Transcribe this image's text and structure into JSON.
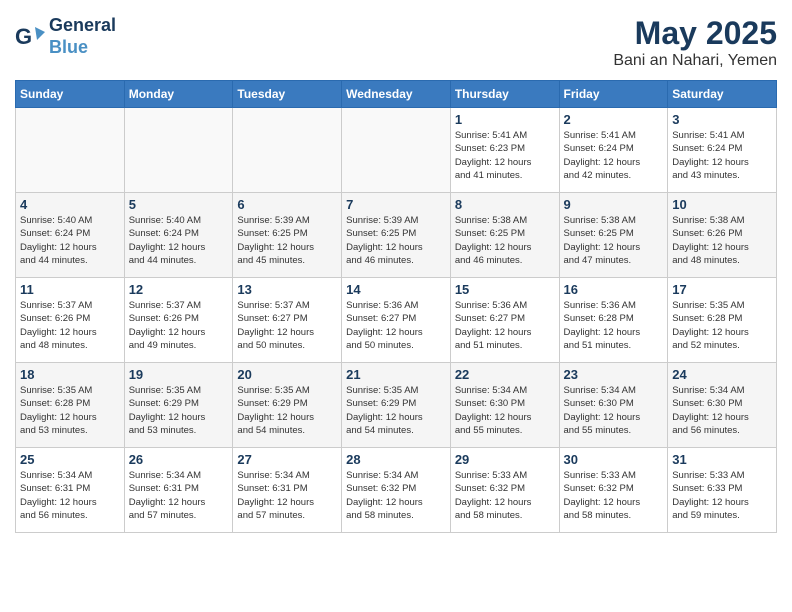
{
  "header": {
    "logo_line1": "General",
    "logo_line2": "Blue",
    "month": "May 2025",
    "location": "Bani an Nahari, Yemen"
  },
  "weekdays": [
    "Sunday",
    "Monday",
    "Tuesday",
    "Wednesday",
    "Thursday",
    "Friday",
    "Saturday"
  ],
  "weeks": [
    [
      {
        "day": "",
        "info": ""
      },
      {
        "day": "",
        "info": ""
      },
      {
        "day": "",
        "info": ""
      },
      {
        "day": "",
        "info": ""
      },
      {
        "day": "1",
        "info": "Sunrise: 5:41 AM\nSunset: 6:23 PM\nDaylight: 12 hours\nand 41 minutes."
      },
      {
        "day": "2",
        "info": "Sunrise: 5:41 AM\nSunset: 6:24 PM\nDaylight: 12 hours\nand 42 minutes."
      },
      {
        "day": "3",
        "info": "Sunrise: 5:41 AM\nSunset: 6:24 PM\nDaylight: 12 hours\nand 43 minutes."
      }
    ],
    [
      {
        "day": "4",
        "info": "Sunrise: 5:40 AM\nSunset: 6:24 PM\nDaylight: 12 hours\nand 44 minutes."
      },
      {
        "day": "5",
        "info": "Sunrise: 5:40 AM\nSunset: 6:24 PM\nDaylight: 12 hours\nand 44 minutes."
      },
      {
        "day": "6",
        "info": "Sunrise: 5:39 AM\nSunset: 6:25 PM\nDaylight: 12 hours\nand 45 minutes."
      },
      {
        "day": "7",
        "info": "Sunrise: 5:39 AM\nSunset: 6:25 PM\nDaylight: 12 hours\nand 46 minutes."
      },
      {
        "day": "8",
        "info": "Sunrise: 5:38 AM\nSunset: 6:25 PM\nDaylight: 12 hours\nand 46 minutes."
      },
      {
        "day": "9",
        "info": "Sunrise: 5:38 AM\nSunset: 6:25 PM\nDaylight: 12 hours\nand 47 minutes."
      },
      {
        "day": "10",
        "info": "Sunrise: 5:38 AM\nSunset: 6:26 PM\nDaylight: 12 hours\nand 48 minutes."
      }
    ],
    [
      {
        "day": "11",
        "info": "Sunrise: 5:37 AM\nSunset: 6:26 PM\nDaylight: 12 hours\nand 48 minutes."
      },
      {
        "day": "12",
        "info": "Sunrise: 5:37 AM\nSunset: 6:26 PM\nDaylight: 12 hours\nand 49 minutes."
      },
      {
        "day": "13",
        "info": "Sunrise: 5:37 AM\nSunset: 6:27 PM\nDaylight: 12 hours\nand 50 minutes."
      },
      {
        "day": "14",
        "info": "Sunrise: 5:36 AM\nSunset: 6:27 PM\nDaylight: 12 hours\nand 50 minutes."
      },
      {
        "day": "15",
        "info": "Sunrise: 5:36 AM\nSunset: 6:27 PM\nDaylight: 12 hours\nand 51 minutes."
      },
      {
        "day": "16",
        "info": "Sunrise: 5:36 AM\nSunset: 6:28 PM\nDaylight: 12 hours\nand 51 minutes."
      },
      {
        "day": "17",
        "info": "Sunrise: 5:35 AM\nSunset: 6:28 PM\nDaylight: 12 hours\nand 52 minutes."
      }
    ],
    [
      {
        "day": "18",
        "info": "Sunrise: 5:35 AM\nSunset: 6:28 PM\nDaylight: 12 hours\nand 53 minutes."
      },
      {
        "day": "19",
        "info": "Sunrise: 5:35 AM\nSunset: 6:29 PM\nDaylight: 12 hours\nand 53 minutes."
      },
      {
        "day": "20",
        "info": "Sunrise: 5:35 AM\nSunset: 6:29 PM\nDaylight: 12 hours\nand 54 minutes."
      },
      {
        "day": "21",
        "info": "Sunrise: 5:35 AM\nSunset: 6:29 PM\nDaylight: 12 hours\nand 54 minutes."
      },
      {
        "day": "22",
        "info": "Sunrise: 5:34 AM\nSunset: 6:30 PM\nDaylight: 12 hours\nand 55 minutes."
      },
      {
        "day": "23",
        "info": "Sunrise: 5:34 AM\nSunset: 6:30 PM\nDaylight: 12 hours\nand 55 minutes."
      },
      {
        "day": "24",
        "info": "Sunrise: 5:34 AM\nSunset: 6:30 PM\nDaylight: 12 hours\nand 56 minutes."
      }
    ],
    [
      {
        "day": "25",
        "info": "Sunrise: 5:34 AM\nSunset: 6:31 PM\nDaylight: 12 hours\nand 56 minutes."
      },
      {
        "day": "26",
        "info": "Sunrise: 5:34 AM\nSunset: 6:31 PM\nDaylight: 12 hours\nand 57 minutes."
      },
      {
        "day": "27",
        "info": "Sunrise: 5:34 AM\nSunset: 6:31 PM\nDaylight: 12 hours\nand 57 minutes."
      },
      {
        "day": "28",
        "info": "Sunrise: 5:34 AM\nSunset: 6:32 PM\nDaylight: 12 hours\nand 58 minutes."
      },
      {
        "day": "29",
        "info": "Sunrise: 5:33 AM\nSunset: 6:32 PM\nDaylight: 12 hours\nand 58 minutes."
      },
      {
        "day": "30",
        "info": "Sunrise: 5:33 AM\nSunset: 6:32 PM\nDaylight: 12 hours\nand 58 minutes."
      },
      {
        "day": "31",
        "info": "Sunrise: 5:33 AM\nSunset: 6:33 PM\nDaylight: 12 hours\nand 59 minutes."
      }
    ]
  ]
}
